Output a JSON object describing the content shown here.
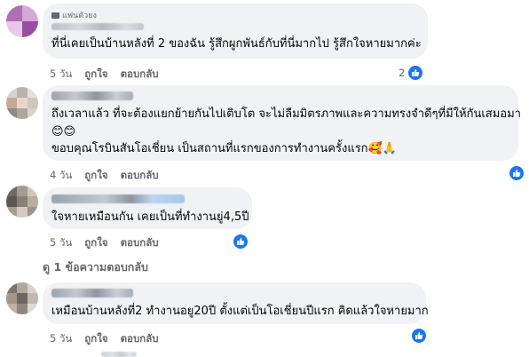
{
  "comments": [
    {
      "badge": "แฟนตัวยง",
      "text": "ที่นี่เคยเป็นบ้านหลังที่ 2 ของฉัน รู้สึกผูกพันธ์กับที่นี่มากไป รู้สึกใจหายมากค่ะ",
      "time": "5 วัน",
      "like": "ถูกใจ",
      "reply": "ตอบกลับ",
      "reaction_count": "2"
    },
    {
      "text_line1": "ถึงเวลาแล้ว ที่จะต้องแยกย้ายกันไปเติบโต จะไม่ลืมมิตรภาพและความทรงจำดีๆที่มีให้กันเสมอมา",
      "text_line2": "😊😊",
      "text_line3": "ขอบคุณโรบินสันโอเชี่ยน เป็นสถานที่แรกของการทำงานครั้งแรก🥰🙏",
      "time": "4 วัน",
      "like": "ถูกใจ",
      "reply": "ตอบกลับ"
    },
    {
      "text": "ใจหายเหมือนกัน เคยเป็นที่ทำงานยู่4,5ปี",
      "time": "5 วัน",
      "like": "ถูกใจ",
      "reply": "ตอบกลับ",
      "view_replies": "ดู 1 ข้อความตอบกลับ"
    },
    {
      "text": "เหมือนบ้านหลังที่2 ทำงานอยู20ปี ตั้งแต่เป็นโอเชี่ยนปีแรก คิดแล้วใจหายมาก",
      "time": "5 วัน",
      "like": "ถูกใจ",
      "reply": "ตอบกลับ"
    }
  ],
  "colors": {
    "like_blue": "#1877f2",
    "bubble": "#f0f2f5",
    "meta": "#65676b"
  },
  "icons": {
    "reaction": "thumbs-up-icon"
  }
}
